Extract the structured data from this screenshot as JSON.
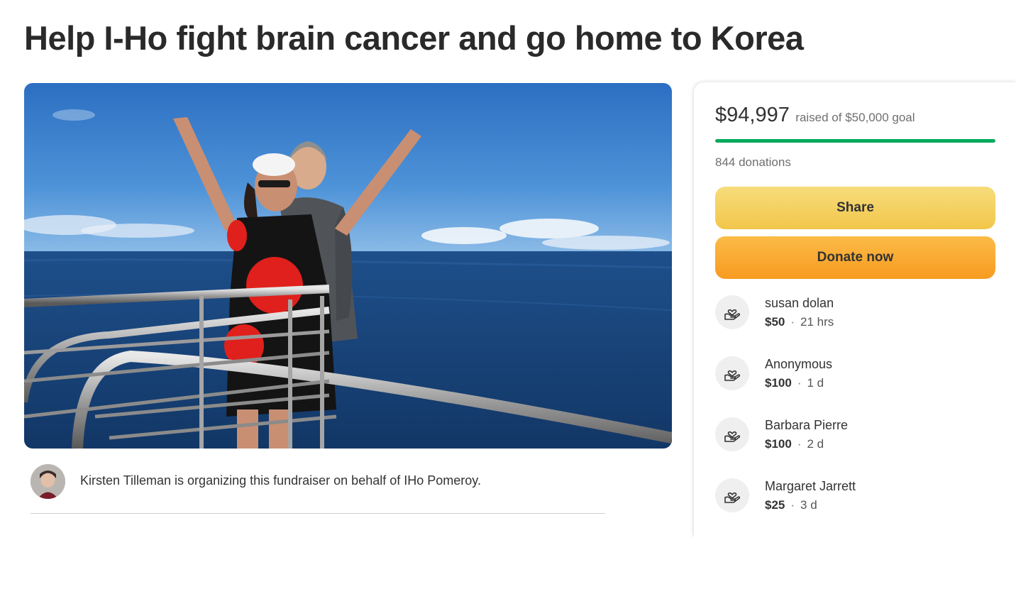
{
  "campaign": {
    "title": "Help I-Ho fight brain cancer and go home to Korea",
    "organizer_text": "Kirsten Tilleman is organizing this fundraiser on behalf of IHo Pomeroy."
  },
  "stats": {
    "raised": "$94,997",
    "goal_text": "raised of $50,000 goal",
    "progress_fraction": 1.0,
    "donation_count": "844 donations"
  },
  "buttons": {
    "share": "Share",
    "donate": "Donate now"
  },
  "donations": [
    {
      "name": "susan dolan",
      "amount": "$50",
      "time": "21 hrs"
    },
    {
      "name": "Anonymous",
      "amount": "$100",
      "time": "1 d"
    },
    {
      "name": "Barbara Pierre",
      "amount": "$100",
      "time": "2 d"
    },
    {
      "name": "Margaret Jarrett",
      "amount": "$25",
      "time": "3 d"
    }
  ],
  "icons": {
    "donor": "heart-in-hand-icon"
  },
  "colors": {
    "progress": "#02a95c",
    "share_button": "#f2c64b",
    "donate_button": "#f79b20"
  }
}
